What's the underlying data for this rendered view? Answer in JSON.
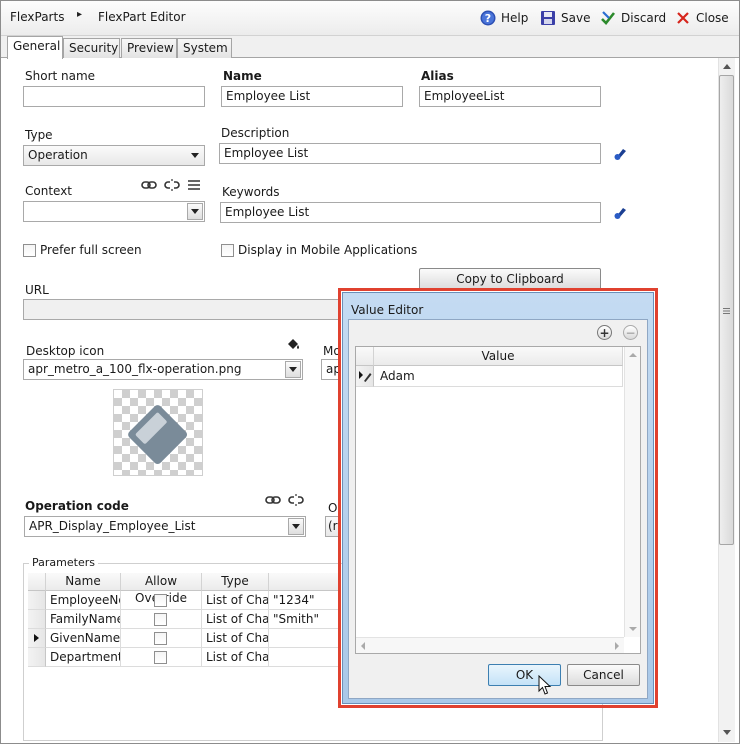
{
  "header": {
    "breadcrumb_root": "FlexParts",
    "breadcrumb_sep": "▸",
    "breadcrumb_current": "FlexPart Editor",
    "help_label": "Help",
    "save_label": "Save",
    "discard_label": "Discard",
    "close_label": "Close"
  },
  "tabs": [
    {
      "label": "General",
      "active": true
    },
    {
      "label": "Security"
    },
    {
      "label": "Preview"
    },
    {
      "label": "System"
    }
  ],
  "form": {
    "short_name_label": "Short name",
    "short_name_value": "",
    "name_label": "Name",
    "name_value": "Employee List",
    "alias_label": "Alias",
    "alias_value": "EmployeeList",
    "type_label": "Type",
    "type_value": "Operation",
    "description_label": "Description",
    "description_value": "Employee List",
    "context_label": "Context",
    "context_value": "",
    "keywords_label": "Keywords",
    "keywords_value": "Employee List",
    "prefer_full_screen_label": "Prefer full screen",
    "display_mobile_label": "Display in Mobile Applications",
    "copy_clipboard_label": "Copy to Clipboard",
    "url_label": "URL",
    "url_value": "",
    "desktop_icon_label": "Desktop icon",
    "desktop_icon_value": "apr_metro_a_100_flx-operation.png",
    "mobile_icon_label_partial": "Mo",
    "mobile_icon_value_partial": "ap",
    "operation_code_label": "Operation code",
    "operation_code_value": "APR_Display_Employee_List",
    "op_label_partial": "O",
    "op_value_partial": "(r"
  },
  "parameters": {
    "legend": "Parameters",
    "columns": [
      "Name",
      "Allow Override",
      "Type"
    ],
    "rows": [
      {
        "name": "EmployeeNo",
        "type": "List of Char",
        "value": "\"1234\""
      },
      {
        "name": "FamilyName",
        "type": "List of Char",
        "value": "\"Smith\""
      },
      {
        "name": "GivenName",
        "type": "List of Char",
        "value": "",
        "current": true
      },
      {
        "name": "Department",
        "type": "List of Char",
        "value": ""
      }
    ]
  },
  "dialog": {
    "title": "Value Editor",
    "column_header": "Value",
    "rows": [
      {
        "value": "Adam"
      }
    ],
    "ok_label": "OK",
    "cancel_label": "Cancel"
  },
  "colors": {
    "highlight_outline": "#e0412f",
    "dialog_frame": "#b6d0ec",
    "ok_button": "#d7ecfb"
  }
}
